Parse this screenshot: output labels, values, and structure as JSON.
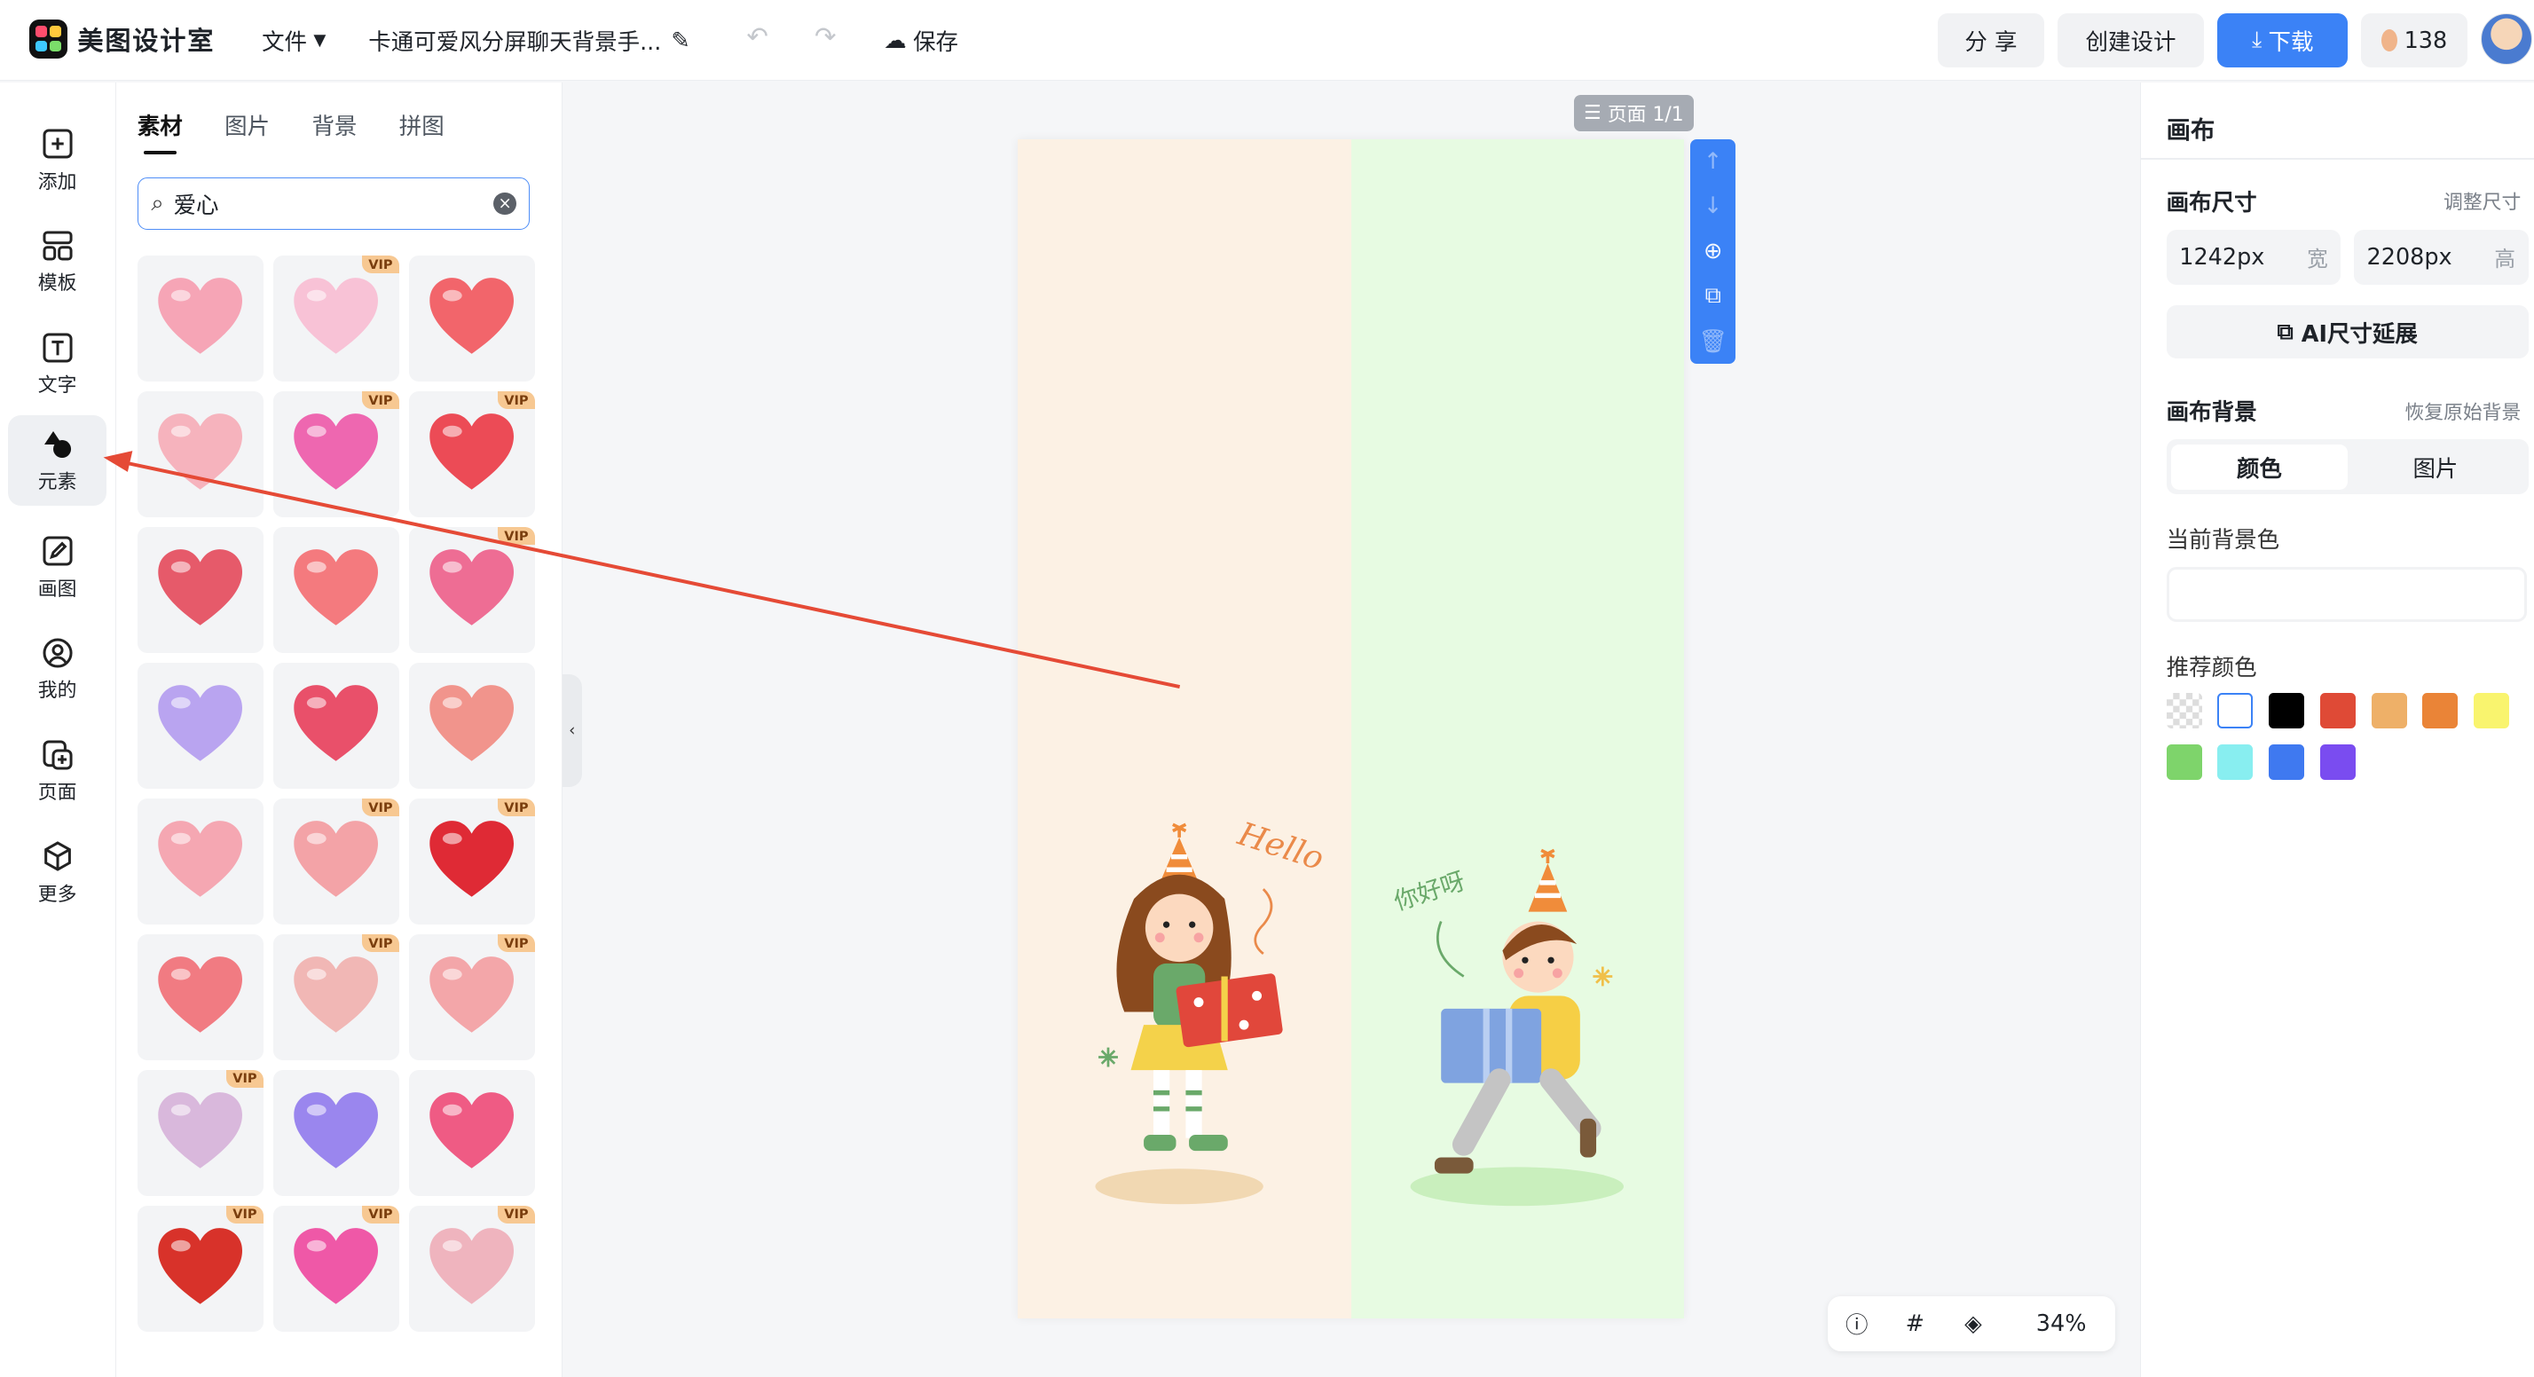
{
  "app": {
    "name": "美图设计室"
  },
  "topbar": {
    "file_menu": "文件",
    "doc_title": "卡通可爱风分屏聊天背景手...",
    "save": "保存",
    "share": "分 享",
    "create": "创建设计",
    "download": "下载",
    "credits": "138"
  },
  "leftnav": [
    {
      "label": "添加",
      "icon": "plus-square-icon"
    },
    {
      "label": "模板",
      "icon": "template-icon"
    },
    {
      "label": "文字",
      "icon": "text-icon"
    },
    {
      "label": "元素",
      "icon": "shapes-icon",
      "active": true
    },
    {
      "label": "画图",
      "icon": "pencil-icon"
    },
    {
      "label": "我的",
      "icon": "user-icon"
    },
    {
      "label": "页面",
      "icon": "page-add-icon"
    },
    {
      "label": "更多",
      "icon": "cube-icon"
    }
  ],
  "panel": {
    "tabs": [
      "素材",
      "图片",
      "背景",
      "拼图"
    ],
    "active_tab": "素材",
    "search_value": "爱心",
    "vip_label": "VIP",
    "items": [
      {
        "name": "pink-heart-ring",
        "vip": false,
        "color": "#f6a5b6"
      },
      {
        "name": "winged-pink-heart",
        "vip": true,
        "color": "#f8c2d6"
      },
      {
        "name": "double-red-hearts",
        "vip": false,
        "color": "#f2656b"
      },
      {
        "name": "pink-heart-pair",
        "vip": false,
        "color": "#f6b3bd"
      },
      {
        "name": "glossy-magenta-heart",
        "vip": true,
        "color": "#ee67b0"
      },
      {
        "name": "red-heart-pair",
        "vip": true,
        "color": "#ec4b56"
      },
      {
        "name": "outline-hearts",
        "vip": false,
        "color": "#e65a6a"
      },
      {
        "name": "coral-heart-pair",
        "vip": false,
        "color": "#f47a7e"
      },
      {
        "name": "pixel-heart",
        "vip": true,
        "color": "#ee6d94"
      },
      {
        "name": "purple-heart-ring",
        "vip": false,
        "color": "#b9a4f0"
      },
      {
        "name": "winged-face-heart",
        "vip": false,
        "color": "#e9506a"
      },
      {
        "name": "love-envelope",
        "vip": false,
        "color": "#f1948c"
      },
      {
        "name": "pink-3d-hearts",
        "vip": false,
        "color": "#f5a7b2"
      },
      {
        "name": "peach-3d-hearts",
        "vip": true,
        "color": "#f3a3a7"
      },
      {
        "name": "red-love-heart",
        "vip": true,
        "color": "#df2a35"
      },
      {
        "name": "coral-twin-hearts",
        "vip": false,
        "color": "#f17b82"
      },
      {
        "name": "floating-hearts",
        "vip": true,
        "color": "#f1b7b5"
      },
      {
        "name": "heart-faces",
        "vip": true,
        "color": "#f3a6a9"
      },
      {
        "name": "lilac-hearts",
        "vip": true,
        "color": "#d9b8dc"
      },
      {
        "name": "violet-heart-ring",
        "vip": false,
        "color": "#9a86ee"
      },
      {
        "name": "glossy-pink-heart",
        "vip": false,
        "color": "#ef5b84"
      },
      {
        "name": "red-gold-hearts",
        "vip": true,
        "color": "#d8322a"
      },
      {
        "name": "magenta-twin-hearts",
        "vip": true,
        "color": "#ef58a7"
      },
      {
        "name": "fluffy-pink-heart",
        "vip": true,
        "color": "#efb4be"
      }
    ]
  },
  "canvas": {
    "page_badge": "页面 1/1",
    "left_bg": "#fcf1e4",
    "right_bg": "#e7fbe2",
    "hello_text": "Hello",
    "nihao_text": "你好呀",
    "zoom": "34%"
  },
  "rightpanel": {
    "title": "画布",
    "size_label": "画布尺寸",
    "adjust_link": "调整尺寸",
    "width_value": "1242px",
    "width_unit": "宽",
    "height_value": "2208px",
    "height_unit": "高",
    "ai_extend": "AI尺寸延展",
    "bg_label": "画布背景",
    "restore_link": "恢复原始背景",
    "seg_color": "颜色",
    "seg_image": "图片",
    "current_bg": "当前背景色",
    "recommend": "推荐颜色",
    "swatches": [
      "transparent",
      "#ffffff",
      "#000000",
      "#df4a36",
      "#eeb068",
      "#ea8437",
      "#f9f46e",
      "#7ed46b",
      "#88eef0",
      "#3f79f0",
      "#7a4cf0"
    ]
  },
  "annotation": {
    "arrow_color": "#e54a36"
  }
}
